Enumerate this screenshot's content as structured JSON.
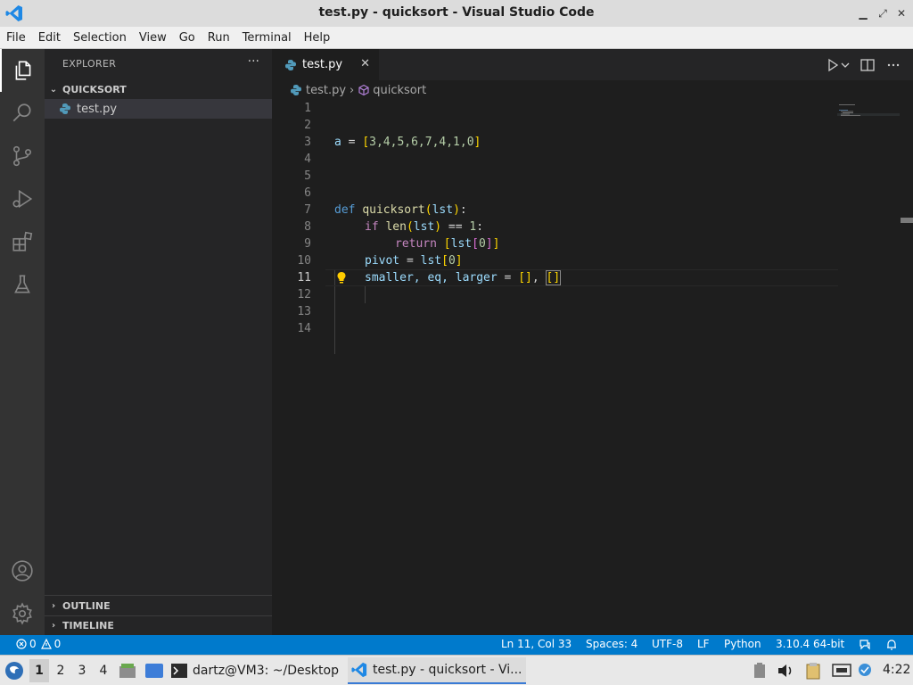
{
  "window": {
    "title": "test.py - quicksort - Visual Studio Code",
    "min": "▁",
    "max": "⤢",
    "close": "✕"
  },
  "menu": [
    "File",
    "Edit",
    "Selection",
    "View",
    "Go",
    "Run",
    "Terminal",
    "Help"
  ],
  "activity_bar": [
    "files-icon",
    "search-icon",
    "source-control-icon",
    "run-debug-icon",
    "extensions-icon",
    "testing-icon",
    "account-icon",
    "settings-gear-icon"
  ],
  "sidebar": {
    "header": "EXPLORER",
    "more": "···",
    "folder": "QUICKSORT",
    "file": "test.py",
    "outline": "OUTLINE",
    "timeline": "TIMELINE"
  },
  "editor": {
    "tab_label": "test.py",
    "tab_close": "✕",
    "breadcrumb_file": "test.py",
    "breadcrumb_sep": "›",
    "breadcrumb_symbol": "quicksort",
    "line_numbers": [
      "1",
      "2",
      "3",
      "4",
      "5",
      "6",
      "7",
      "8",
      "9",
      "10",
      "11",
      "12",
      "13",
      "14"
    ],
    "current_line": 11
  },
  "code": {
    "l3": {
      "a": "a",
      "eq": " = ",
      "lb": "[",
      "nums": "3,4,5,6,7,4,1,0",
      "rb": "]"
    },
    "l7": {
      "def": "def",
      "sp": " ",
      "fn": "quicksort",
      "lp": "(",
      "arg": "lst",
      "rp": ")",
      "colon": ":"
    },
    "l8": {
      "if": "if",
      "sp": " ",
      "len": "len",
      "lp": "(",
      "arg": "lst",
      "rp": ")",
      "op": " == ",
      "one": "1",
      "colon": ":"
    },
    "l9": {
      "ret": "return",
      "sp": " ",
      "lb": "[",
      "lst": "lst",
      "lb2": "[",
      "zero": "0",
      "rb2": "]",
      "rb": "]"
    },
    "l10": {
      "pivot": "pivot",
      "eq": " = ",
      "lst": "lst",
      "lb": "[",
      "zero": "0",
      "rb": "]"
    },
    "l11": {
      "vars": "smaller, eq, larger",
      "eq": " = ",
      "b1": "[]",
      "comma": ", ",
      "b2": "[]"
    }
  },
  "status": {
    "errors": "0",
    "warnings": "0",
    "position": "Ln 11, Col 33",
    "spaces": "Spaces: 4",
    "encoding": "UTF-8",
    "eol": "LF",
    "language": "Python",
    "interpreter": "3.10.4 64-bit"
  },
  "taskbar": {
    "workspaces": [
      "1",
      "2",
      "3",
      "4"
    ],
    "terminal_task": "dartz@VM3: ~/Desktop",
    "vscode_task": "test.py - quicksort - Vi...",
    "clock": "4:22"
  },
  "colors": {
    "accent": "#007acc",
    "keyword": "#569cd6",
    "function": "#dcdcaa",
    "variable": "#9cdcfe",
    "number": "#b5cea8",
    "bracket": "#ffd700"
  }
}
